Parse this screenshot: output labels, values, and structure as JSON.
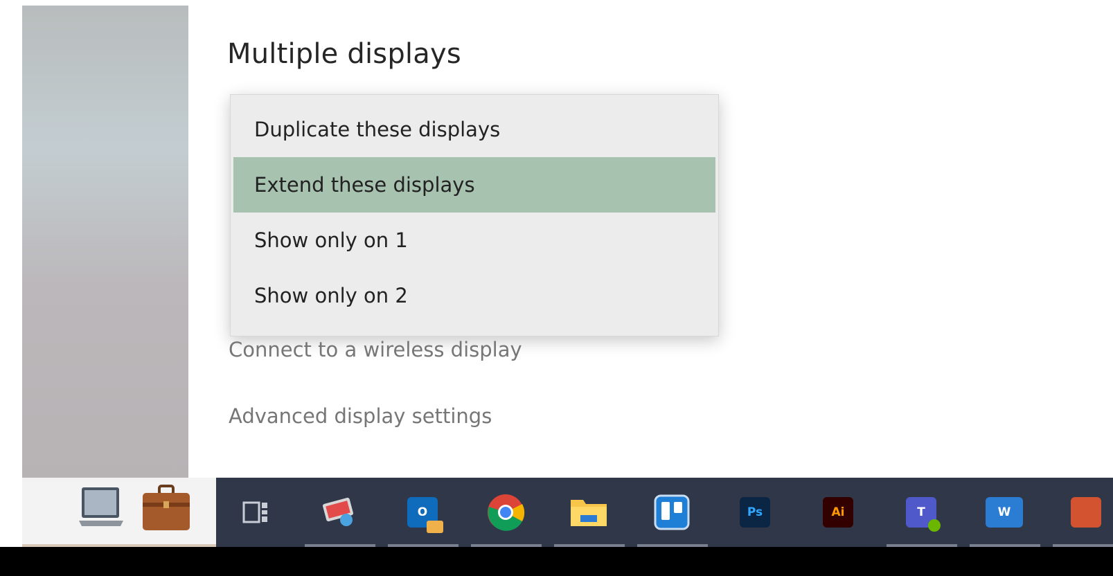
{
  "section": {
    "title": "Multiple displays"
  },
  "dropdown": {
    "options": [
      {
        "label": "Duplicate these displays",
        "selected": false
      },
      {
        "label": "Extend these displays",
        "selected": true
      },
      {
        "label": "Show only on 1",
        "selected": false
      },
      {
        "label": "Show only on 2",
        "selected": false
      }
    ],
    "selected_color": "#a8c2b0"
  },
  "links": {
    "wireless": "Connect to a wireless display",
    "advanced": "Advanced display settings"
  },
  "taskbar": {
    "background": "#2f3749",
    "apps": [
      {
        "icon": "task-view-icon"
      },
      {
        "icon": "remote-desktop-icon",
        "running": true
      },
      {
        "icon": "outlook-icon",
        "glyph": "O",
        "color": "#0f6cbd",
        "running": true
      },
      {
        "icon": "chrome-icon",
        "running": true
      },
      {
        "icon": "file-explorer-icon",
        "running": true
      },
      {
        "icon": "trello-icon",
        "color": "#1f7fd6",
        "running": true
      },
      {
        "icon": "photoshop-icon",
        "glyph": "Ps",
        "color": "#0b2544",
        "text_color": "#31a8ff"
      },
      {
        "icon": "illustrator-icon",
        "glyph": "Ai",
        "color": "#330000",
        "text_color": "#ff9a00"
      },
      {
        "icon": "teams-icon",
        "glyph": "T",
        "color": "#5059c9",
        "running": true
      },
      {
        "icon": "word-icon",
        "glyph": "W",
        "color": "#2b7cd3",
        "running": true
      }
    ]
  }
}
